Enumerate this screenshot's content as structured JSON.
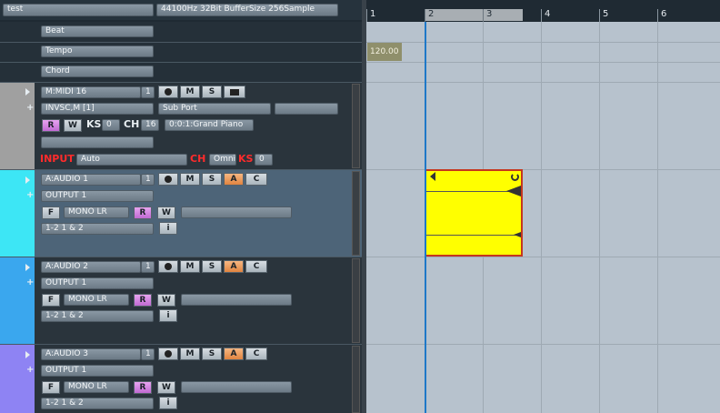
{
  "header": {
    "project_name": "test",
    "audio_info": "44100Hz 32Bit BufferSize 256Sample"
  },
  "global_tracks": {
    "beat": "Beat",
    "tempo": "Tempo",
    "chord": "Chord"
  },
  "midi_track": {
    "name": "M:MIDI 16",
    "number": "1",
    "instrument": "INVSC,M [1]",
    "sub_port": "Sub Port",
    "r_label": "R",
    "w_label": "W",
    "ks_label": "KS",
    "ks_value": "0",
    "ch_label": "CH",
    "ch_value": "16",
    "program": "0:0:1:Grand Piano",
    "input_label": "INPUT",
    "input_value": "Auto",
    "input_ch_label": "CH",
    "input_ch_value": "Omni",
    "input_ks_label": "KS",
    "input_ks_value": "0"
  },
  "audio_tracks": [
    {
      "name": "A:AUDIO 1",
      "number": "1",
      "output": "OUTPUT 1",
      "f": "F",
      "mode": "MONO LR",
      "r": "R",
      "w": "W",
      "routing": "1-2 1 & 2",
      "info": "i",
      "a": "A",
      "c": "C",
      "color": "#3de6f5"
    },
    {
      "name": "A:AUDIO 2",
      "number": "1",
      "output": "OUTPUT 1",
      "f": "F",
      "mode": "MONO LR",
      "r": "R",
      "w": "W",
      "routing": "1-2 1 & 2",
      "info": "i",
      "a": "A",
      "c": "C",
      "color": "#3aa7ee"
    },
    {
      "name": "A:AUDIO 3",
      "number": "1",
      "output": "OUTPUT 1",
      "f": "F",
      "mode": "MONO LR",
      "r": "R",
      "w": "W",
      "routing": "1-2 1 & 2",
      "info": "i",
      "a": "A",
      "c": "C",
      "color": "#8e83f3"
    }
  ],
  "track_buttons": {
    "mute": "M",
    "solo": "S"
  },
  "ruler": {
    "bars": [
      "1",
      "2",
      "3",
      "4",
      "5",
      "6"
    ]
  },
  "tempo_value": "120.00",
  "colors": {
    "clip": "#ffff00",
    "clip_border": "#c5361d",
    "playhead": "#1e78c8",
    "timeline_bg": "#b7c2cd"
  }
}
